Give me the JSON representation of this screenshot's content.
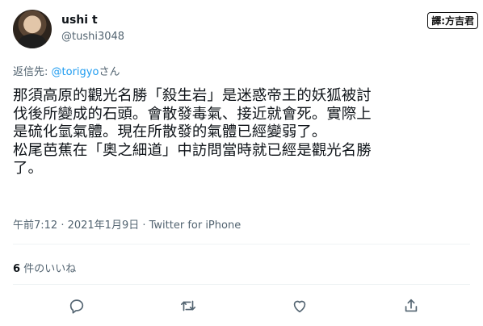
{
  "author": {
    "name": "ushi t",
    "handle": "@tushi3048"
  },
  "watermark": "譯:方吉君",
  "reply": {
    "prefix": "返信先:",
    "mention": "@torigyo",
    "suffix": "さん"
  },
  "tweet": {
    "text": "那須高原的觀光名勝「殺生岩」是迷惑帝王的妖狐被討\n伐後所變成的石頭。會散發毒氣、接近就會死。實際上\n是硫化氫氣體。現在所散發的氣體已經變弱了。\n松尾芭蕉在「奧之細道」中訪問當時就已經是觀光名勝\n了。"
  },
  "meta": {
    "timestamp": "午前7:12 · 2021年1月9日 · Twitter for iPhone"
  },
  "stats": {
    "likes_count": "6",
    "likes_label": "件のいいね"
  },
  "icons": [
    "reply-icon",
    "retweet-icon",
    "like-icon",
    "share-icon"
  ],
  "colors": {
    "accent": "#1d9bf0",
    "text": "#0f1419",
    "secondary": "#536471"
  }
}
